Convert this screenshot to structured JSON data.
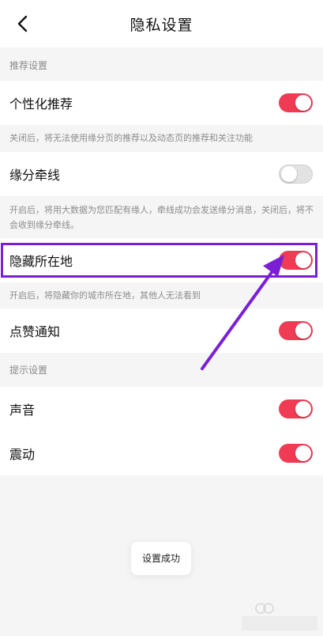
{
  "header": {
    "title": "隐私设置",
    "back_icon": "chevron-left-icon"
  },
  "sections": {
    "recommend_title": "推荐设置",
    "prompt_title": "提示设置"
  },
  "settings": {
    "personalized": {
      "label": "个性化推荐",
      "on": true,
      "desc": "关闭后，将无法使用缘分页的推荐以及动态页的推荐和关注功能"
    },
    "fate_line": {
      "label": "缘分牵线",
      "on": false,
      "desc": "开启后，将用大数据为您匹配有缘人，牵线成功会发送缘分消息，关闭后，将不会收到缘分牵线。"
    },
    "hide_location": {
      "label": "隐藏所在地",
      "on": true,
      "desc": "开启后，将隐藏你的城市所在地，其他人无法看到"
    },
    "like_notify": {
      "label": "点赞通知",
      "on": true
    },
    "sound": {
      "label": "声音",
      "on": true
    },
    "vibrate": {
      "label": "震动",
      "on": true
    }
  },
  "toast": "设置成功",
  "colors": {
    "toggle_on": "#ef3c54",
    "toggle_off": "#e2e2e2",
    "annotation": "#7b1fd6"
  }
}
